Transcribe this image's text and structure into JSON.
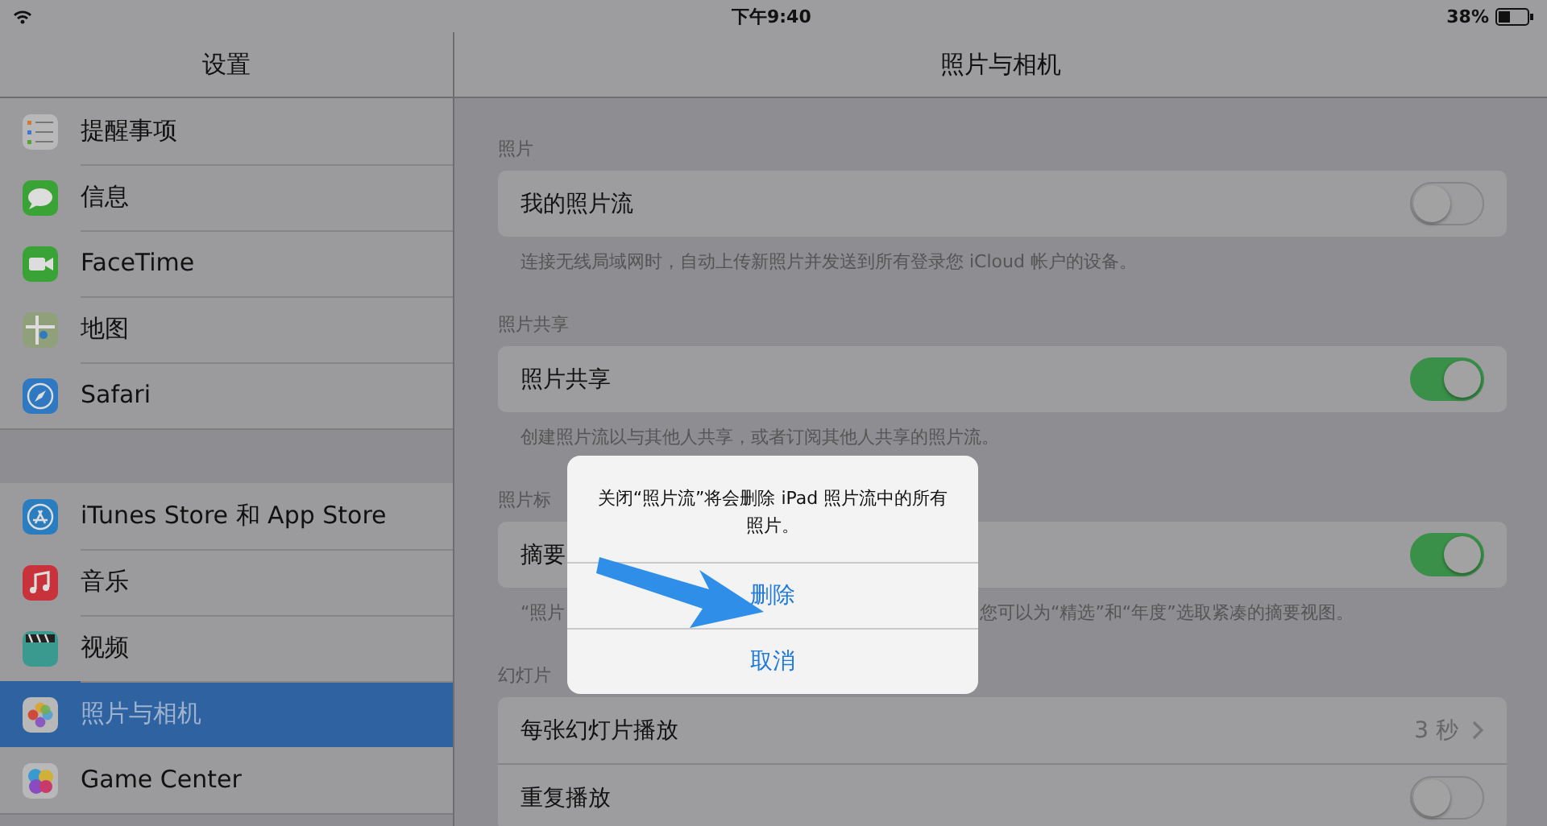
{
  "status_bar": {
    "time": "下午9:40",
    "battery": "38%"
  },
  "sidebar": {
    "title": "设置",
    "groups": [
      {
        "items": [
          {
            "label": "提醒事项",
            "color": "#b8b8b8",
            "selected": false
          },
          {
            "label": "信息",
            "color": "#3aa336",
            "selected": false
          },
          {
            "label": "FaceTime",
            "color": "#3aa336",
            "selected": false
          },
          {
            "label": "地图",
            "color": "#8fa07a",
            "selected": false
          },
          {
            "label": "Safari",
            "color": "#2f78c2",
            "selected": false
          }
        ]
      },
      {
        "items": [
          {
            "label": "iTunes Store 和 App Store",
            "color": "#2a7ec0",
            "selected": false
          },
          {
            "label": "音乐",
            "color": "#c8323a",
            "selected": false
          },
          {
            "label": "视频",
            "color": "#3a9a90",
            "selected": false
          },
          {
            "label": "照片与相机",
            "color": "#b8b8b8",
            "selected": true
          },
          {
            "label": "Game Center",
            "color": "#b8b8b8",
            "selected": false
          }
        ]
      }
    ]
  },
  "detail": {
    "title": "照片与相机",
    "sections": [
      {
        "header": "照片",
        "rows": [
          {
            "kind": "toggle",
            "label": "我的照片流",
            "on": false
          }
        ],
        "footer": [
          "连接无线局域网时，自动上传新照片并发送到所有登录您 iCloud 帐户的设备。"
        ]
      },
      {
        "header": "照片共享",
        "rows": [
          {
            "kind": "toggle",
            "label": "照片共享",
            "on": true
          }
        ],
        "footer": [
          "创建照片流以与其他人共享，或者订阅其他人共享的照片流。"
        ]
      },
      {
        "header": "照片标",
        "rows": [
          {
            "kind": "toggle",
            "label": "摘要",
            "on": true
          }
        ],
        "footer": [
          "“照片",
          "您可以为“精选”和“年度”选取紧凑的摘要视图。"
        ]
      },
      {
        "header": "幻灯片",
        "rows": [
          {
            "kind": "disclosure",
            "label": "每张幻灯片播放",
            "value": "3 秒"
          },
          {
            "kind": "toggle",
            "label": "重复播放",
            "on": false
          }
        ]
      }
    ]
  },
  "alert": {
    "message": "关闭“照片流”将会删除 iPad 照片流中的所有照片。",
    "buttons": [
      "删除",
      "取消"
    ]
  }
}
